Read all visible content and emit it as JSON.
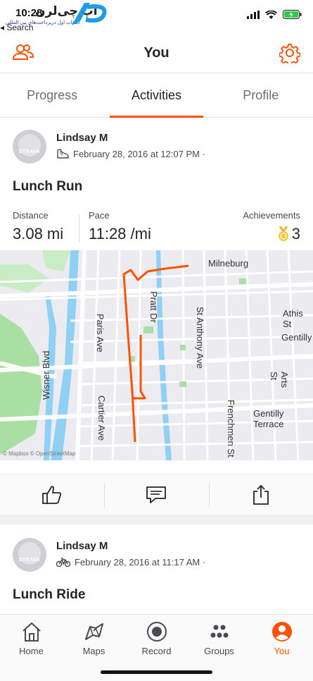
{
  "status_bar": {
    "time": "10:28",
    "back_label": "◂ Search",
    "watermark_title": "اپ چی‌لرن",
    "watermark_subtitle": "انتخاب اول درپرداخت‌های بین المللی"
  },
  "header": {
    "title": "You"
  },
  "tabs": [
    {
      "label": "Progress"
    },
    {
      "label": "Activities"
    },
    {
      "label": "Profile"
    }
  ],
  "avatar_brand": "STRAVA",
  "activities": [
    {
      "athlete": "Lindsay M",
      "sport_icon": "shoe-icon",
      "date": "February 28, 2016 at 12:07 PM ·",
      "title": "Lunch Run",
      "stats": {
        "distance_label": "Distance",
        "distance_value": "3.08 mi",
        "pace_label": "Pace",
        "pace_value": "11:28 /mi",
        "achievements_label": "Achievements",
        "achievements_value": "3"
      },
      "map_labels": {
        "milneburg": "Milneburg",
        "athis": "Athis St",
        "gentilly": "Gentilly",
        "gentilly_terrace": "Gentilly Terrace",
        "paris_ave": "Paris Ave",
        "pratt_dr": "Pratt Dr",
        "st_anthony": "St Anthony Ave",
        "arts_st": "Arts St",
        "wisner": "Wisner Blvd",
        "cartier": "Cartier Ave",
        "frenchmen": "Frenchmen St",
        "attribution": "© Mapbox © OpenStreetMap"
      }
    },
    {
      "athlete": "Lindsay M",
      "sport_icon": "bike-icon",
      "date": "February 28, 2016 at 11:17 AM ·",
      "title": "Lunch Ride"
    }
  ],
  "bottom_nav": [
    {
      "label": "Home",
      "icon": "home-icon"
    },
    {
      "label": "Maps",
      "icon": "map-icon"
    },
    {
      "label": "Record",
      "icon": "record-icon"
    },
    {
      "label": "Groups",
      "icon": "groups-icon"
    },
    {
      "label": "You",
      "icon": "profile-icon",
      "active": true
    }
  ],
  "colors": {
    "accent": "#fc5200",
    "text": "#242428",
    "map_bg": "#ecebf0",
    "park": "#a9dfa2",
    "water": "#8fd0f5"
  }
}
